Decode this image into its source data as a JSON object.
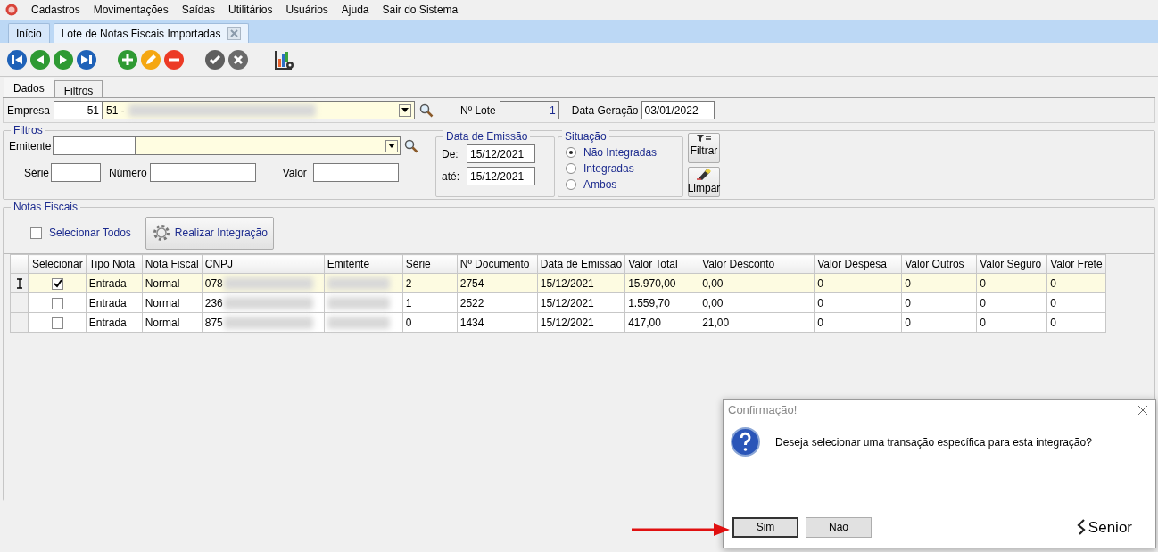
{
  "menu": [
    "Cadastros",
    "Movimentações",
    "Saídas",
    "Utilitários",
    "Usuários",
    "Ajuda",
    "Sair do Sistema"
  ],
  "doc_tabs": [
    {
      "label": "Início",
      "selected": false,
      "closable": false
    },
    {
      "label": "Lote de Notas Fiscais Importadas",
      "selected": true,
      "closable": true
    }
  ],
  "form_tabs": [
    {
      "label": "Dados",
      "selected": true
    },
    {
      "label": "Filtros",
      "selected": false
    }
  ],
  "header": {
    "empresa_label": "Empresa",
    "empresa_code": "51",
    "empresa_name": "51 -",
    "lote_label": "Nº Lote",
    "lote_value": "1",
    "data_label": "Data Geração",
    "data_value": "03/01/2022"
  },
  "filtros": {
    "title": "Filtros",
    "emitente_label": "Emitente",
    "serie_label": "Série",
    "numero_label": "Número",
    "valor_label": "Valor",
    "emissao_title": "Data de Emissão",
    "de_label": "De:",
    "de_value": "15/12/2021",
    "ate_label": "até:",
    "ate_value": "15/12/2021",
    "situacao_title": "Situação",
    "situacao": [
      {
        "label": "Não Integradas",
        "selected": true
      },
      {
        "label": "Integradas",
        "selected": false
      },
      {
        "label": "Ambos",
        "selected": false
      }
    ],
    "filtrar": "Filtrar",
    "limpar": "Limpar"
  },
  "notas": {
    "title": "Notas Fiscais",
    "select_all": {
      "label": "Selecionar Todos",
      "checked": false
    },
    "integrar": "Realizar Integração"
  },
  "table": {
    "columns": [
      "Selecionar",
      "Tipo Nota",
      "Nota Fiscal",
      "CNPJ",
      "Emitente",
      "Série",
      "Nº Documento",
      "Data de Emissão",
      "Valor Total",
      "Valor Desconto",
      "Valor Despesa",
      "Valor Outros",
      "Valor Seguro",
      "Valor Frete"
    ],
    "rows": [
      {
        "current": true,
        "checked": true,
        "cells": [
          "",
          "Entrada",
          "Normal",
          "078",
          "",
          "2",
          "2754",
          "15/12/2021",
          "15.970,00",
          "0,00",
          "0",
          "0",
          "0",
          "0"
        ]
      },
      {
        "current": false,
        "checked": false,
        "cells": [
          "",
          "Entrada",
          "Normal",
          "236",
          "",
          "1",
          "2522",
          "15/12/2021",
          "1.559,70",
          "0,00",
          "0",
          "0",
          "0",
          "0"
        ]
      },
      {
        "current": false,
        "checked": false,
        "cells": [
          "",
          "Entrada",
          "Normal",
          "875",
          "",
          "0",
          "1434",
          "15/12/2021",
          "417,00",
          "21,00",
          "0",
          "0",
          "0",
          "0"
        ]
      }
    ]
  },
  "dialog": {
    "title": "Confirmação!",
    "message": "Deseja selecionar uma transação específica para esta integração?",
    "buttons": [
      {
        "label": "Sim",
        "focused": true
      },
      {
        "label": "Não",
        "focused": false
      }
    ],
    "brand": "Senior"
  }
}
